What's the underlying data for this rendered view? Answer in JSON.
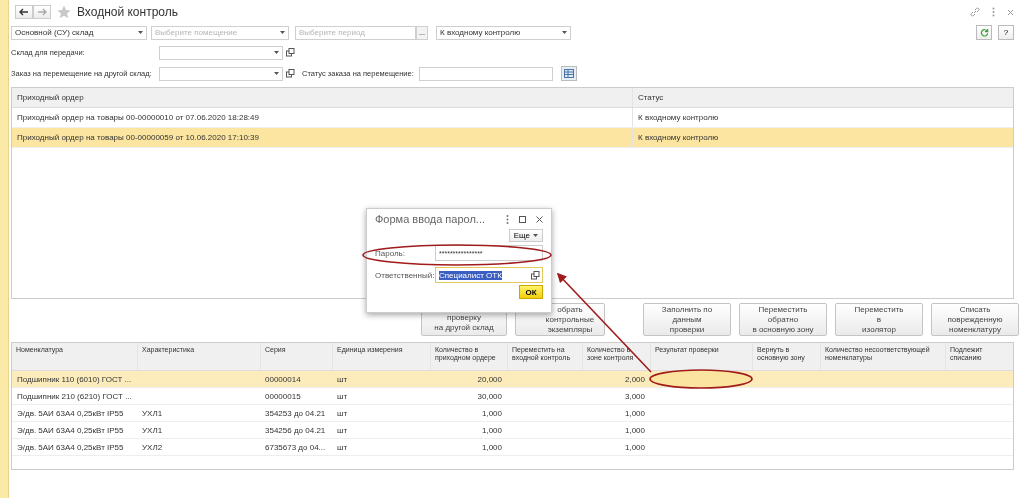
{
  "window": {
    "title": "Входной контроль"
  },
  "filters": [
    {
      "kind": "select",
      "value": "Основной (СУ) склад"
    },
    {
      "kind": "select",
      "placeholder": "Выберите помещение"
    },
    {
      "kind": "period",
      "placeholder": "Выберите период",
      "button": "..."
    },
    {
      "kind": "select",
      "value": "К входному контролю"
    }
  ],
  "warehouse_field": {
    "label": "Склад для передачи:"
  },
  "order_field": {
    "label": "Заказ на перемещение на другой склад:"
  },
  "order_status": {
    "label": "Статус заказа на перемещение:"
  },
  "help_button": "?",
  "orders_table": {
    "columns": [
      "Приходный ордер",
      "Статус"
    ],
    "rows": [
      {
        "cells": [
          "Приходный ордер на товары 00-00000010 от 07.06.2020 18:28:49",
          "К входному контролю"
        ],
        "selected": false
      },
      {
        "cells": [
          "Приходный ордер на товары 00-00000059 от 10.06.2020 17:10:39",
          "К входному контролю"
        ],
        "selected": true
      }
    ]
  },
  "action_buttons": [
    "проверку\nна другой склад",
    "обрать\nконтрольные\nэкземпляры",
    "Заполнить по\nданным\nпроверки",
    "Переместить\nобратно\nв основную зону",
    "Переместить\nв\nизолятор",
    "Списать\nповрежденную\nноменклатуру"
  ],
  "items_table": {
    "columns": [
      "Номенклатура",
      "Характеристика",
      "Серия",
      "Единица измерения",
      "Количество в приходном ордере",
      "Переместить на входной контроль",
      "Количество в зоне контроля",
      "Результат проверки",
      "Вернуть в основную зону",
      "Количество несоответствующей номенклатуры",
      "Подлежит списанию"
    ],
    "rows": [
      {
        "cells": [
          "Подшипник 110 (6010) ГОСТ ...",
          "",
          "00000014",
          "шт",
          "20,000",
          "",
          "2,000",
          "",
          "",
          "",
          ""
        ],
        "selected": true
      },
      {
        "cells": [
          "Подшипник 210 (6210) ГОСТ ...",
          "",
          "00000015",
          "шт",
          "30,000",
          "",
          "3,000",
          "",
          "",
          "",
          ""
        ],
        "selected": false
      },
      {
        "cells": [
          "Э/дв. 5АИ 63А4 0,25кВт IP55",
          "УХЛ1",
          "354253 до 04.21",
          "шт",
          "1,000",
          "",
          "1,000",
          "",
          "",
          "",
          ""
        ],
        "selected": false
      },
      {
        "cells": [
          "Э/дв. 5АИ 63А4 0,25кВт IP55",
          "УХЛ1",
          "354256 до 04.21",
          "шт",
          "1,000",
          "",
          "1,000",
          "",
          "",
          "",
          ""
        ],
        "selected": false
      },
      {
        "cells": [
          "Э/дв. 5АИ 63А4 0,25кВт IP55",
          "УХЛ2",
          "6735673 до 04...",
          "шт",
          "1,000",
          "",
          "1,000",
          "",
          "",
          "",
          ""
        ],
        "selected": false
      }
    ]
  },
  "password_dialog": {
    "title": "Форма ввода парол...",
    "more_button": "Еще",
    "password_label": "Пароль:",
    "password_value": "****************",
    "responsible_label": "Ответственный:",
    "responsible_value": "Специалист ОТК",
    "ok_button": "ОК"
  }
}
